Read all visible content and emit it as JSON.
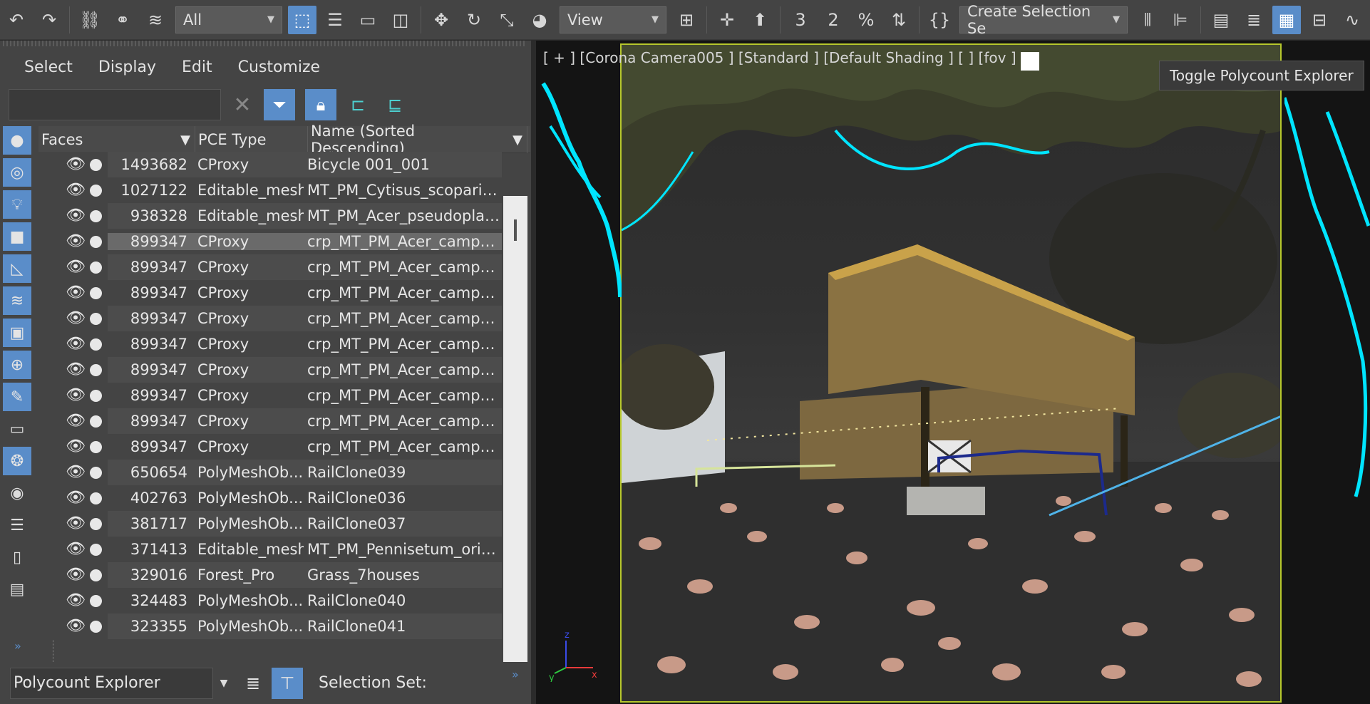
{
  "toolbar": {
    "filter_value": "All",
    "view_value": "View",
    "selection_set_value": "Create Selection Se",
    "snap_label": "3",
    "angle_snap_label": "2",
    "percent_label": "%"
  },
  "menu": [
    "Select",
    "Display",
    "Edit",
    "Customize"
  ],
  "search": {
    "value": "",
    "placeholder": ""
  },
  "columns": {
    "faces": "Faces",
    "type": "PCE Type",
    "name": "Name (Sorted Descending)"
  },
  "rows": [
    {
      "faces": "1493682",
      "type": "CProxy",
      "name": "Bicycle 001_001"
    },
    {
      "faces": "1027122",
      "type": "Editable_mesh",
      "name": "MT_PM_Cytisus_scoparius_"
    },
    {
      "faces": "938328",
      "type": "Editable_mesh",
      "name": "MT_PM_Acer_pseudoplata_"
    },
    {
      "faces": "899347",
      "type": "CProxy",
      "name": "crp_MT_PM_Acer_campes_"
    },
    {
      "faces": "899347",
      "type": "CProxy",
      "name": "crp_MT_PM_Acer_campes_"
    },
    {
      "faces": "899347",
      "type": "CProxy",
      "name": "crp_MT_PM_Acer_campes_"
    },
    {
      "faces": "899347",
      "type": "CProxy",
      "name": "crp_MT_PM_Acer_campes_"
    },
    {
      "faces": "899347",
      "type": "CProxy",
      "name": "crp_MT_PM_Acer_campes_"
    },
    {
      "faces": "899347",
      "type": "CProxy",
      "name": "crp_MT_PM_Acer_campes_"
    },
    {
      "faces": "899347",
      "type": "CProxy",
      "name": "crp_MT_PM_Acer_campes_"
    },
    {
      "faces": "899347",
      "type": "CProxy",
      "name": "crp_MT_PM_Acer_campes_"
    },
    {
      "faces": "899347",
      "type": "CProxy",
      "name": "crp_MT_PM_Acer_campes_"
    },
    {
      "faces": "650654",
      "type": "PolyMeshOb...",
      "name": "RailClone039"
    },
    {
      "faces": "402763",
      "type": "PolyMeshOb...",
      "name": "RailClone036"
    },
    {
      "faces": "381717",
      "type": "PolyMeshOb...",
      "name": "RailClone037"
    },
    {
      "faces": "371413",
      "type": "Editable_mesh",
      "name": "MT_PM_Pennisetum_orient"
    },
    {
      "faces": "329016",
      "type": "Forest_Pro",
      "name": "Grass_7houses"
    },
    {
      "faces": "324483",
      "type": "PolyMeshOb...",
      "name": "RailClone040"
    },
    {
      "faces": "323355",
      "type": "PolyMeshOb...",
      "name": "RailClone041"
    }
  ],
  "selected_row": 3,
  "bottom": {
    "explorer_value": "Polycount Explorer",
    "selection_set_label": "Selection Set:"
  },
  "viewport": {
    "label": "[ + ] [Corona Camera005 ] [Standard ] [Default Shading ] [ ] [fov ]",
    "tooltip": "Toggle Polycount Explorer"
  },
  "colors": {
    "accent": "#5a8dc9",
    "viewport_border": "#b6c72c",
    "highlight": "#00e5ff"
  }
}
